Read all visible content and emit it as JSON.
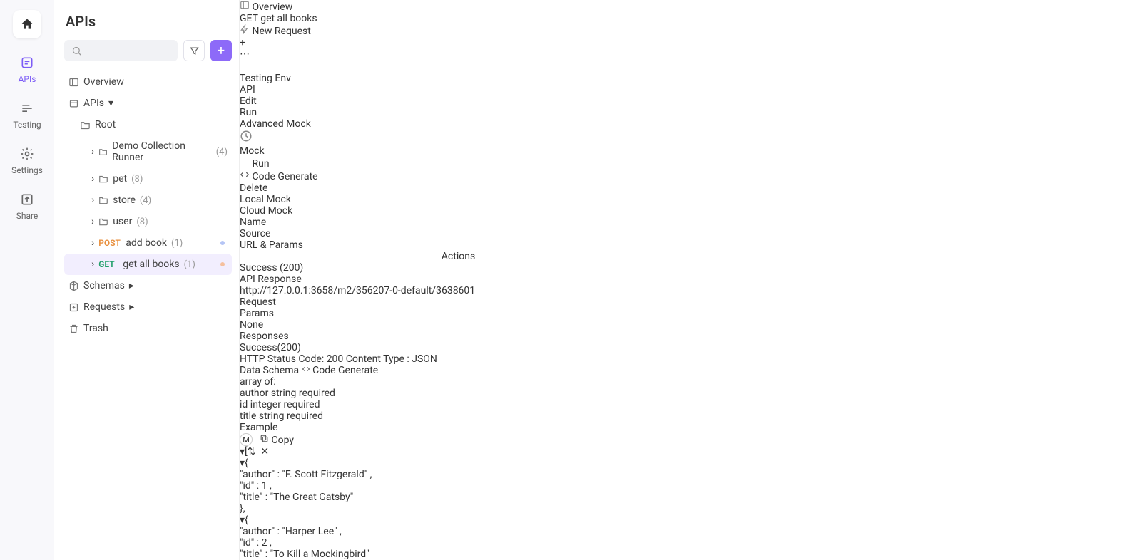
{
  "leftbar": {
    "items": [
      {
        "label": "APIs"
      },
      {
        "label": "Testing"
      },
      {
        "label": "Settings"
      },
      {
        "label": "Share"
      }
    ]
  },
  "sidebar": {
    "title": "APIs",
    "overview": "Overview",
    "apis_root": "APIs",
    "tree": {
      "root": "Root",
      "demo": {
        "label": "Demo Collection Runner",
        "count": "(4)"
      },
      "pet": {
        "label": "pet",
        "count": "(8)"
      },
      "store": {
        "label": "store",
        "count": "(4)"
      },
      "user": {
        "label": "user",
        "count": "(8)"
      },
      "addbook": {
        "method": "POST",
        "label": "add book",
        "count": "(1)"
      },
      "getall": {
        "method": "GET",
        "label": "get all books",
        "count": "(1)"
      }
    },
    "schemas": "Schemas",
    "requests": "Requests",
    "trash": "Trash"
  },
  "tabs": {
    "overview": "Overview",
    "active_method": "GET",
    "active_label": "get all books",
    "newreq": "New Request",
    "env": "Testing Env"
  },
  "subtabs": {
    "api": "API",
    "edit": "Edit",
    "run": "Run",
    "mock": "Advanced Mock"
  },
  "mock": {
    "title": "Mock",
    "run": "Run",
    "codegen": "Code Generate",
    "delete": "Delete",
    "local": "Local Mock",
    "cloud": "Cloud Mock",
    "cols": {
      "name": "Name",
      "source": "Source",
      "url": "URL & Params",
      "actions": "Actions"
    },
    "row": {
      "name": "Success (200)",
      "source": "API Response",
      "url": "http://127.0.0.1:3658/m2/356207-0-default/3638601",
      "action": "Request"
    }
  },
  "params": {
    "title": "Params",
    "none": "None"
  },
  "responses": {
    "title": "Responses",
    "tab": "Success(200)",
    "status": "HTTP Status Code: 200",
    "ctype": "Content Type : JSON",
    "schema_head": "Data Schema",
    "codegen": "Code Generate",
    "example_head": "Example",
    "copy": "Copy",
    "array_of": "array of:",
    "required": "required",
    "fields": [
      {
        "name": "author",
        "type": "string"
      },
      {
        "name": "id",
        "type": "integer"
      },
      {
        "name": "title",
        "type": "string"
      }
    ],
    "example_books": [
      {
        "author": "F. Scott Fitzgerald",
        "id": 1,
        "title": "The Great Gatsby"
      },
      {
        "author": "Harper Lee",
        "id": 2,
        "title": "To Kill a Mockingbird"
      }
    ]
  }
}
